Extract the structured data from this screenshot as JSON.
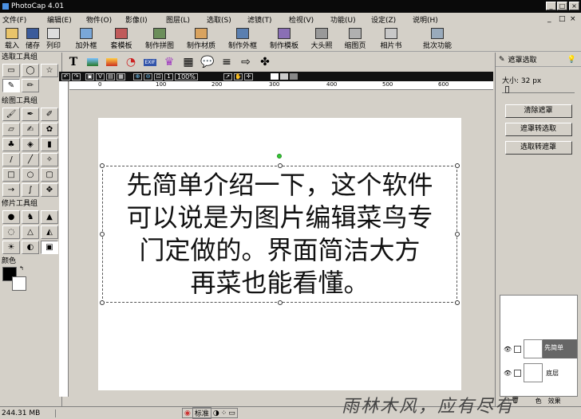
{
  "app": {
    "title": "PhotoCap 4.01"
  },
  "menu": [
    "文件(F)",
    "编辑(E)",
    "物件(O)",
    "影像(I)",
    "图层(L)",
    "选取(S)",
    "滤镜(T)",
    "检视(V)",
    "功能(U)",
    "设定(Z)",
    "说明(H)"
  ],
  "toolbar": [
    "载入",
    "储存",
    "列印",
    "加外框",
    "套模板",
    "制作拼图",
    "制作材质",
    "制作外框",
    "制作模板",
    "大头照",
    "缩图页",
    "相片书",
    "批次功能"
  ],
  "zoom": "100%",
  "ruler_ticks": [
    "0",
    "100",
    "200",
    "300",
    "400",
    "500",
    "600"
  ],
  "left_groups": {
    "select": "选取工具组",
    "draw": "绘图工具组",
    "retouch": "修片工具组",
    "color": "颜色"
  },
  "canvas_text": [
    "先简单介绍一下，这个软件",
    "可以说是为图片编辑菜鸟专",
    "门定做的。界面简洁大方",
    "再菜也能看懂。"
  ],
  "right_panel": {
    "title": "遮罩选取",
    "size_label": "大小: 32 px",
    "buttons": [
      "清除遮罩",
      "遮罩转选取",
      "选取转遮罩"
    ]
  },
  "layers": [
    {
      "name": "先简单"
    },
    {
      "name": "底层"
    }
  ],
  "layer_buttons": {
    "color": "色",
    "effects": "效果"
  },
  "status": {
    "memory": "244.31 MB",
    "mode": "标准"
  },
  "watermark": "雨林木风，应有尽有"
}
